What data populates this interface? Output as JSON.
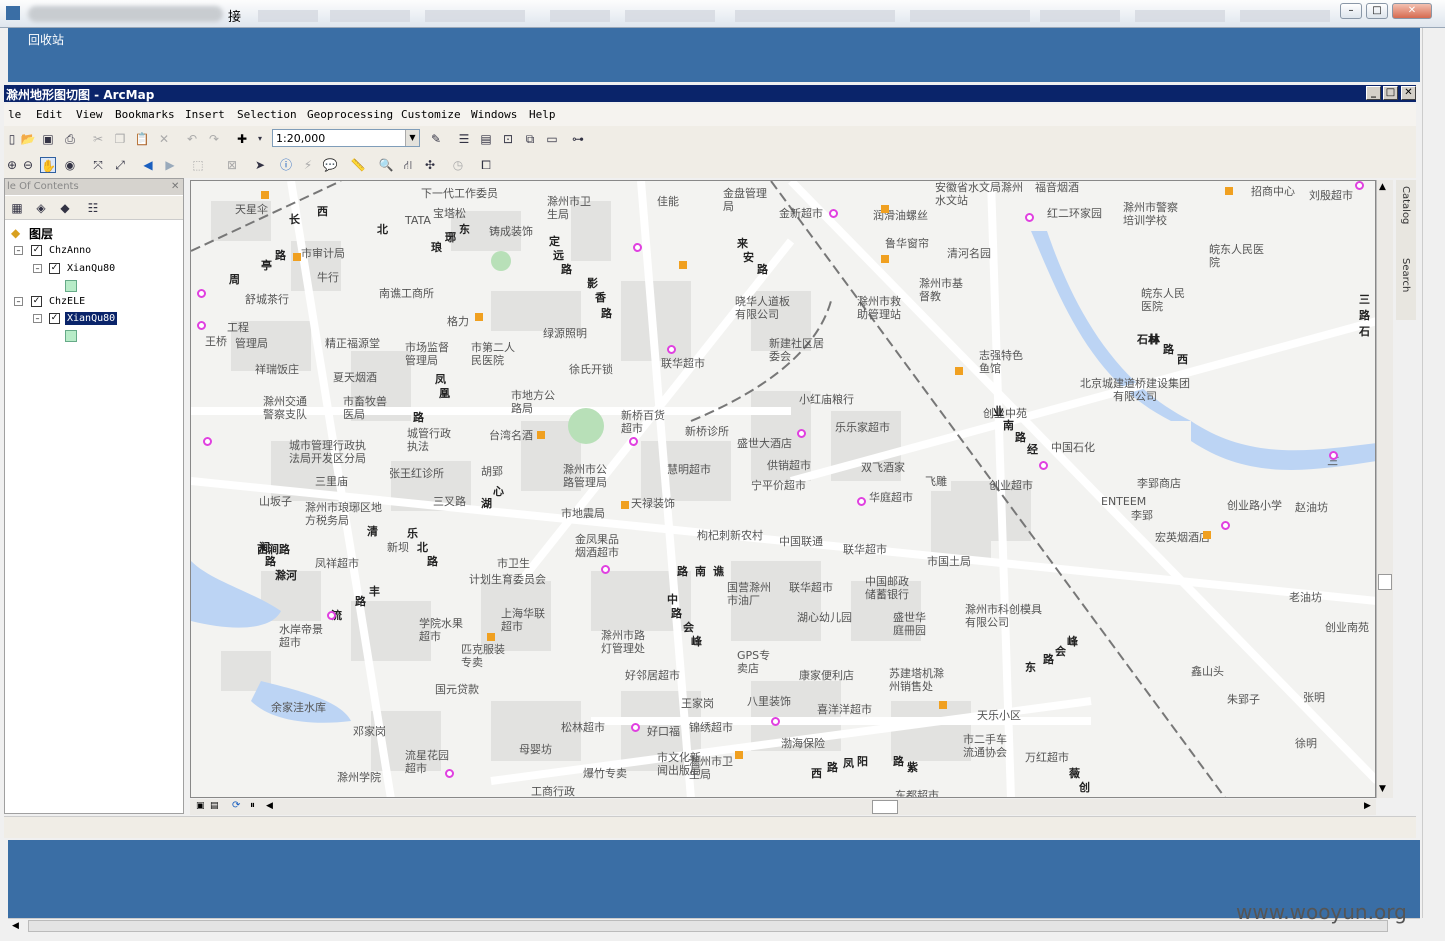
{
  "outer_window": {
    "title_suffix": "接",
    "recycle_bin": "回收站",
    "watermark": "www.wooyun.org"
  },
  "arcmap": {
    "title": "滁州地形图切图 - ArcMap",
    "menu": [
      "le",
      "Edit",
      "View",
      "Bookmarks",
      "Insert",
      "Selection",
      "Geoprocessing",
      "Customize",
      "Windows",
      "Help"
    ],
    "scale": "1:20,000",
    "toc": {
      "header": "le Of Contents",
      "root": "图层",
      "layers": [
        {
          "group": "ChzAnno",
          "child": "XianQu80"
        },
        {
          "group": "ChzELE",
          "child": "XianQu80"
        }
      ]
    },
    "side_tabs": [
      "Catalog",
      "Search"
    ]
  },
  "map": {
    "places": [
      "天星伞",
      "长",
      "下一代工作委员",
      "TATA",
      "宝塔松",
      "铸成装饰",
      "滁州市卫生局",
      "佳能",
      "金盘管理局",
      "金新超市",
      "润滑油螺丝",
      "鲁华窗帘",
      "安徽省水文局滁州水文站",
      "福音烟酒",
      "红二环家园",
      "滁州市警察培训学校",
      "招商中心",
      "刘殷超市",
      "皖东人民医院",
      "市审计局",
      "牛行",
      "舒城茶行",
      "南谯工商所",
      "格力",
      "绿源照明",
      "徐氏开锁",
      "联华超市",
      "晓华人道板有限公司",
      "新建社区居委会",
      "滁州市救助管理站",
      "滁州市基督教",
      "清河名园",
      "志强特色鱼馆",
      "北京城建道桥建设集团有限公司",
      "石林",
      "皖东人民医院",
      "工程",
      "王桥",
      "管理局",
      "精正福源堂",
      "市场监督管理局",
      "市第二人民医院",
      "祥瑞饭庄",
      "夏天烟酒",
      "滁州交通警察支队",
      "市畜牧兽医局",
      "城管行政执法",
      "台湾名酒",
      "新桥百货超市",
      "新桥诊所",
      "小红庙粮行",
      "乐乐家超市",
      "盛世大酒店",
      "供销超市",
      "双飞酒家",
      "飞雕",
      "创业中苑",
      "中国石化",
      "市地方公路局",
      "滁州市公路管理局",
      "慧明超市",
      "宁平价超市",
      "华庭超市",
      "创业超市",
      "李郢商店",
      "创业路小学",
      "城市管理行政执法局开发区分局",
      "三里庙",
      "胡郢",
      "三叉路",
      "张王红诊所",
      "天禄装饰",
      "市地震局",
      "山坂子",
      "滁州市琅琊区地方税务局",
      "西涧路",
      "凤祥超市",
      "新坝",
      "金凤果品烟酒超市",
      "枸杞刺新农村",
      "中国联通",
      "联华超市",
      "市国土局",
      "ENTEEM",
      "李郢",
      "宏英烟酒店",
      "赵油坊",
      "计划生育委员会",
      "市卫生",
      "上海华联超市",
      "国营滁州市油厂",
      "联华超市",
      "中国邮政储蓄银行",
      "滁州市科创模具有限公司",
      "老油坊",
      "创业南苑",
      "水岸帝景超市",
      "学院水果超市",
      "匹克服装专卖",
      "滁州市路灯管理处",
      "湖心幼儿园",
      "盛世华庭冊园",
      "鑫山头",
      "朱郢子",
      "张明",
      "GPS专卖店",
      "康家便利店",
      "苏建塔机滁州销售处",
      "国元贷款",
      "王家岗",
      "八里装饰",
      "好邻居超市",
      "喜洋洋超市",
      "天乐小区",
      "余家洼水库",
      "邓家岗",
      "松林超市",
      "好口福",
      "锦绣超市",
      "渤海保险",
      "市二手车流通协会",
      "万红超市",
      "徐明",
      "流星花园超市",
      "母婴坊",
      "市文化新闻出版局",
      "滁州市卫生局",
      "爆竹专卖",
      "滁州学院",
      "工商行政",
      "东都超市"
    ],
    "roads": [
      "西",
      "北",
      "亭",
      "路",
      "琅",
      "琊",
      "东",
      "定",
      "远",
      "路",
      "影",
      "香",
      "路",
      "来",
      "安",
      "路",
      "凤",
      "凰",
      "路",
      "清",
      "流",
      "路",
      "丰",
      "乐",
      "北",
      "路",
      "湖",
      "心",
      "路",
      "南",
      "谯",
      "中",
      "路",
      "会",
      "峰",
      "东",
      "路",
      "会",
      "峰",
      "西",
      "路",
      "凤",
      "阳",
      "路",
      "紫",
      "薇",
      "创",
      "业",
      "南",
      "路",
      "经",
      "三",
      "路",
      "石",
      "林",
      "路",
      "西",
      "涧",
      "路",
      "滁河",
      "三",
      "周"
    ]
  }
}
